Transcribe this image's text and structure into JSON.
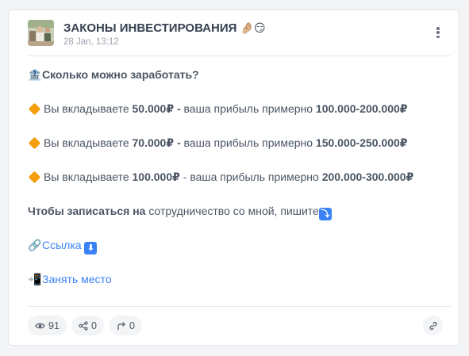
{
  "post": {
    "channel_title": "ЗАКОНЫ ИНВЕСТИРОВАНИЯ",
    "title_emoji": "🤌🏼😏",
    "date": "28 Jan, 13:12"
  },
  "content": {
    "headline_emoji": "🏦",
    "headline": "Сколько можно заработать?",
    "offers": [
      {
        "pre": "Вы вкладываете ",
        "amount": "50.000₽ -",
        "mid": " ваша прибыль примерно ",
        "profit": "100.000-200.000₽"
      },
      {
        "pre": "Вы вкладываете ",
        "amount": "70.000₽ -",
        "mid": " ваша прибыль примерно ",
        "profit": "150.000-250.000₽"
      },
      {
        "pre": "Вы вкладываете ",
        "amount": "100.000₽",
        "mid": " - ваша прибыль примерно ",
        "profit": "200.000-300.000₽"
      }
    ],
    "cta_bold": "Чтобы записаться на",
    "cta_rest": " сотрудничество со мной, пишите",
    "cta_icon": "⤵",
    "link_emoji": "🔗",
    "link_label": "Ссылка",
    "link_icon": "⬇",
    "reserve_emoji": "📲",
    "reserve_label": "Занять место"
  },
  "footer": {
    "views": "91",
    "reactions": "0",
    "shares": "0"
  },
  "colors": {
    "link": "#3b82f6",
    "diamond": "#f59e0b"
  }
}
